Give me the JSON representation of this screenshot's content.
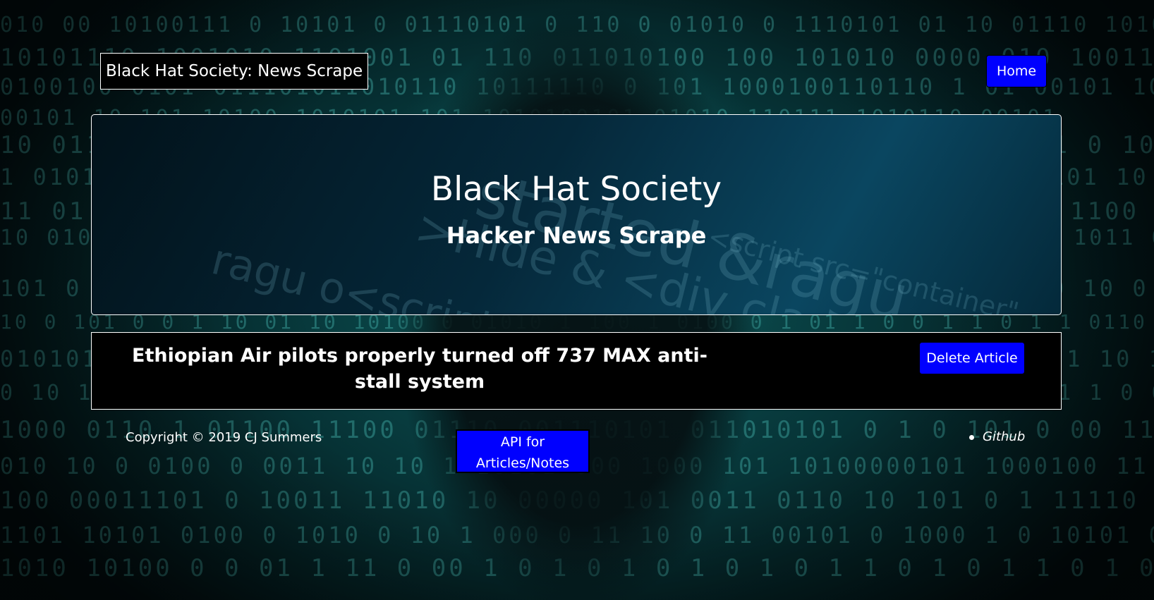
{
  "navbar": {
    "brand": "Black Hat Society: News Scrape",
    "home_label": "Home"
  },
  "jumbotron": {
    "title": "Black Hat Society",
    "subtitle": "Hacker News Scrape"
  },
  "articles": [
    {
      "title": "Ethiopian Air pilots properly turned off 737 MAX anti-stall system",
      "delete_label": "Delete Article"
    }
  ],
  "footer": {
    "copyright": "Copyright © 2019 CJ Summers",
    "api_label": "API for Articles/Notes",
    "github_label": "Github"
  },
  "colors": {
    "button_blue": "#0000ff",
    "card_background": "#000000",
    "text": "#ffffff",
    "background_teal": "#0d5a5c"
  }
}
